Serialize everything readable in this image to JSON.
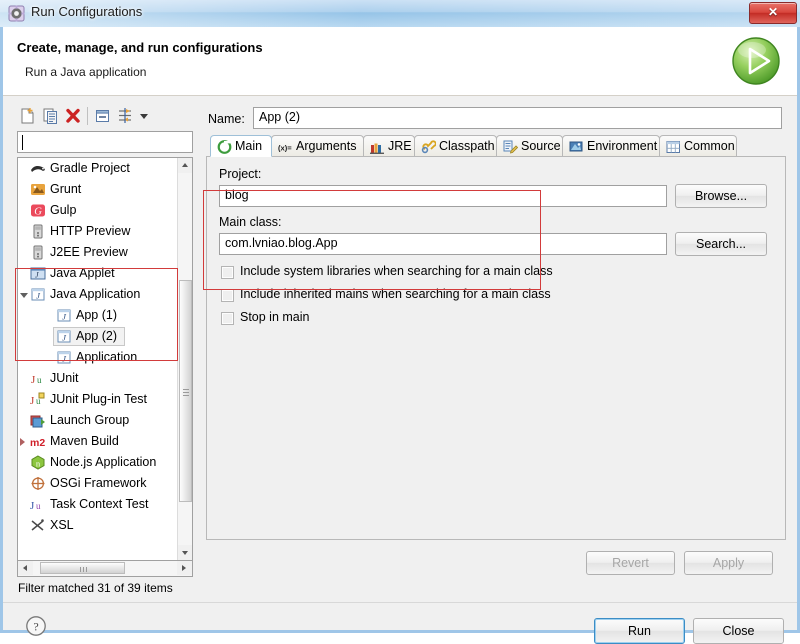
{
  "window": {
    "title": "Run Configurations",
    "title_icon": "run-configurations-gear-icon",
    "close_label": "✕"
  },
  "header": {
    "title": "Create, manage, and run configurations",
    "subtitle": "Run a Java application",
    "badge_icon": "run-play-icon"
  },
  "left_panel": {
    "toolbar": [
      {
        "name": "new-configuration-button",
        "icon": "new-document-icon"
      },
      {
        "name": "duplicate-configuration-button",
        "icon": "copy-icon"
      },
      {
        "name": "delete-configuration-button",
        "icon": "delete-red-x-icon"
      },
      {
        "name": "collapse-all-button",
        "icon": "collapse-all-icon"
      },
      {
        "name": "filter-button",
        "icon": "filter-icon"
      },
      {
        "name": "filter-dropdown-button",
        "icon": "chevron-down-icon"
      }
    ],
    "filter_input": {
      "value": "",
      "placeholder": ""
    },
    "tree": [
      {
        "label": "Gradle Project",
        "indent": 0,
        "icon": "gradle-icon",
        "expander": "none",
        "selected": false
      },
      {
        "label": "Grunt",
        "indent": 0,
        "icon": "grunt-icon",
        "expander": "none",
        "selected": false
      },
      {
        "label": "Gulp",
        "indent": 0,
        "icon": "gulp-icon",
        "expander": "none",
        "selected": false
      },
      {
        "label": "HTTP Preview",
        "indent": 0,
        "icon": "server-icon",
        "expander": "none",
        "selected": false
      },
      {
        "label": "J2EE Preview",
        "indent": 0,
        "icon": "server-icon",
        "expander": "none",
        "selected": false
      },
      {
        "label": "Java Applet",
        "indent": 0,
        "icon": "java-applet-icon",
        "expander": "none",
        "selected": false
      },
      {
        "label": "Java Application",
        "indent": 0,
        "icon": "java-app-icon",
        "expander": "open",
        "selected": false
      },
      {
        "label": "App (1)",
        "indent": 1,
        "icon": "java-app-icon",
        "expander": "none",
        "selected": false
      },
      {
        "label": "App (2)",
        "indent": 1,
        "icon": "java-app-icon",
        "expander": "none",
        "selected": true
      },
      {
        "label": "Application",
        "indent": 1,
        "icon": "java-app-icon",
        "expander": "none",
        "selected": false
      },
      {
        "label": "JUnit",
        "indent": 0,
        "icon": "junit-icon",
        "expander": "none",
        "selected": false
      },
      {
        "label": "JUnit Plug-in Test",
        "indent": 0,
        "icon": "junit-plugin-icon",
        "expander": "none",
        "selected": false
      },
      {
        "label": "Launch Group",
        "indent": 0,
        "icon": "launch-group-icon",
        "expander": "none",
        "selected": false
      },
      {
        "label": "Maven Build",
        "indent": 0,
        "icon": "maven-icon",
        "expander": "closed",
        "selected": false
      },
      {
        "label": "Node.js Application",
        "indent": 0,
        "icon": "nodejs-icon",
        "expander": "none",
        "selected": false
      },
      {
        "label": "OSGi Framework",
        "indent": 0,
        "icon": "osgi-icon",
        "expander": "none",
        "selected": false
      },
      {
        "label": "Task Context Test",
        "indent": 0,
        "icon": "task-context-icon",
        "expander": "none",
        "selected": false
      },
      {
        "label": "XSL",
        "indent": 0,
        "icon": "xsl-icon",
        "expander": "none",
        "selected": false
      }
    ],
    "status": "Filter matched 31 of 39 items"
  },
  "right_panel": {
    "name_label": "Name:",
    "name_value": "App (2)",
    "tabs": [
      {
        "label": "Main",
        "icon": "main-green-circle-icon",
        "active": true
      },
      {
        "label": "Arguments",
        "icon": "arguments-variable-icon",
        "active": false
      },
      {
        "label": "JRE",
        "icon": "jre-books-icon",
        "active": false
      },
      {
        "label": "Classpath",
        "icon": "classpath-icon",
        "active": false
      },
      {
        "label": "Source",
        "icon": "source-icon",
        "active": false
      },
      {
        "label": "Environment",
        "icon": "environment-icon",
        "active": false
      },
      {
        "label": "Common",
        "icon": "common-table-icon",
        "active": false
      }
    ],
    "main_tab": {
      "project_label": "Project:",
      "project_value": "blog",
      "browse_label": "Browse...",
      "main_class_label": "Main class:",
      "main_class_value": "com.lvniao.blog.App",
      "search_label": "Search...",
      "checkboxes": [
        {
          "label": "Include system libraries when searching for a main class",
          "checked": false
        },
        {
          "label": "Include inherited mains when searching for a main class",
          "checked": false
        },
        {
          "label": "Stop in main",
          "checked": false
        }
      ]
    },
    "revert_label": "Revert",
    "apply_label": "Apply"
  },
  "footer": {
    "help_icon": "help-question-icon",
    "run_label": "Run",
    "close_label": "Close"
  },
  "colors": {
    "annotation": "#d23b3b",
    "accent": "#3c8dc5",
    "title_bar": "#a7cdec",
    "run_green": "#76bd43"
  }
}
